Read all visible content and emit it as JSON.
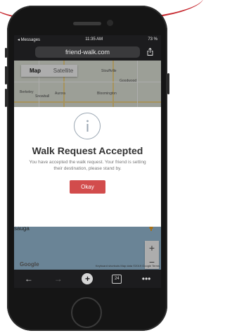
{
  "status": {
    "carrier": "◂ Messages",
    "time": "11:35 AM",
    "battery": "73 %"
  },
  "browser": {
    "url": "friend-walk.com",
    "tabs_count": "24"
  },
  "map": {
    "type_map": "Map",
    "type_satellite": "Satellite",
    "labels": {
      "goodwood": "Goodwood",
      "stouffville": "Stouffville",
      "aurora": "Aurora",
      "bloomington": "Bloomington",
      "snowball": "Snowball",
      "berkeley": "Berkeley",
      "sauga": "sauga"
    },
    "google": "Google",
    "attribution": "Keyboard shortcuts  Map data ©2019 Google  Terms"
  },
  "modal": {
    "title": "Walk Request Accepted",
    "message": "You have accepted the walk request. Your friend is setting their destination, please stand by.",
    "button": "Okay"
  },
  "colors": {
    "accent": "#d24c4c",
    "info_ring": "#9aa6b2",
    "browser_chrome": "#1c1c1e"
  }
}
